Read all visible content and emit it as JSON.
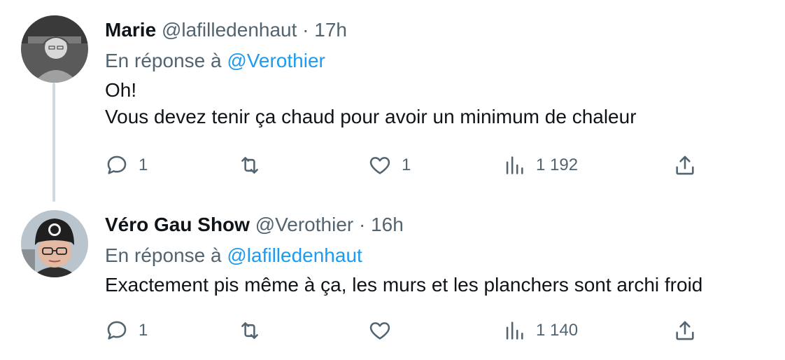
{
  "tweets": [
    {
      "name": "Marie",
      "handle": "@lafilledenhaut",
      "dot": "·",
      "time": "17h",
      "reply_prefix": "En réponse à",
      "reply_to": "@Verothier",
      "text": "Oh!\nVous devez tenir ça chaud pour avoir un minimum de chaleur",
      "replies": "1",
      "retweets": "",
      "likes": "1",
      "views": "1 192"
    },
    {
      "name": "Véro Gau Show",
      "handle": "@Verothier",
      "dot": "·",
      "time": "16h",
      "reply_prefix": "En réponse à",
      "reply_to": "@lafilledenhaut",
      "text": "Exactement pis même à ça, les  murs et les planchers sont archi froid",
      "replies": "1",
      "retweets": "",
      "likes": "",
      "views": "1 140"
    }
  ],
  "icons": {
    "reply": "reply-icon",
    "retweet": "retweet-icon",
    "like": "heart-icon",
    "views": "views-icon",
    "share": "share-icon"
  },
  "colors": {
    "text": "#0f1419",
    "secondary": "#536471",
    "link": "#1d9bf0",
    "thread_line": "#cfd9de"
  }
}
